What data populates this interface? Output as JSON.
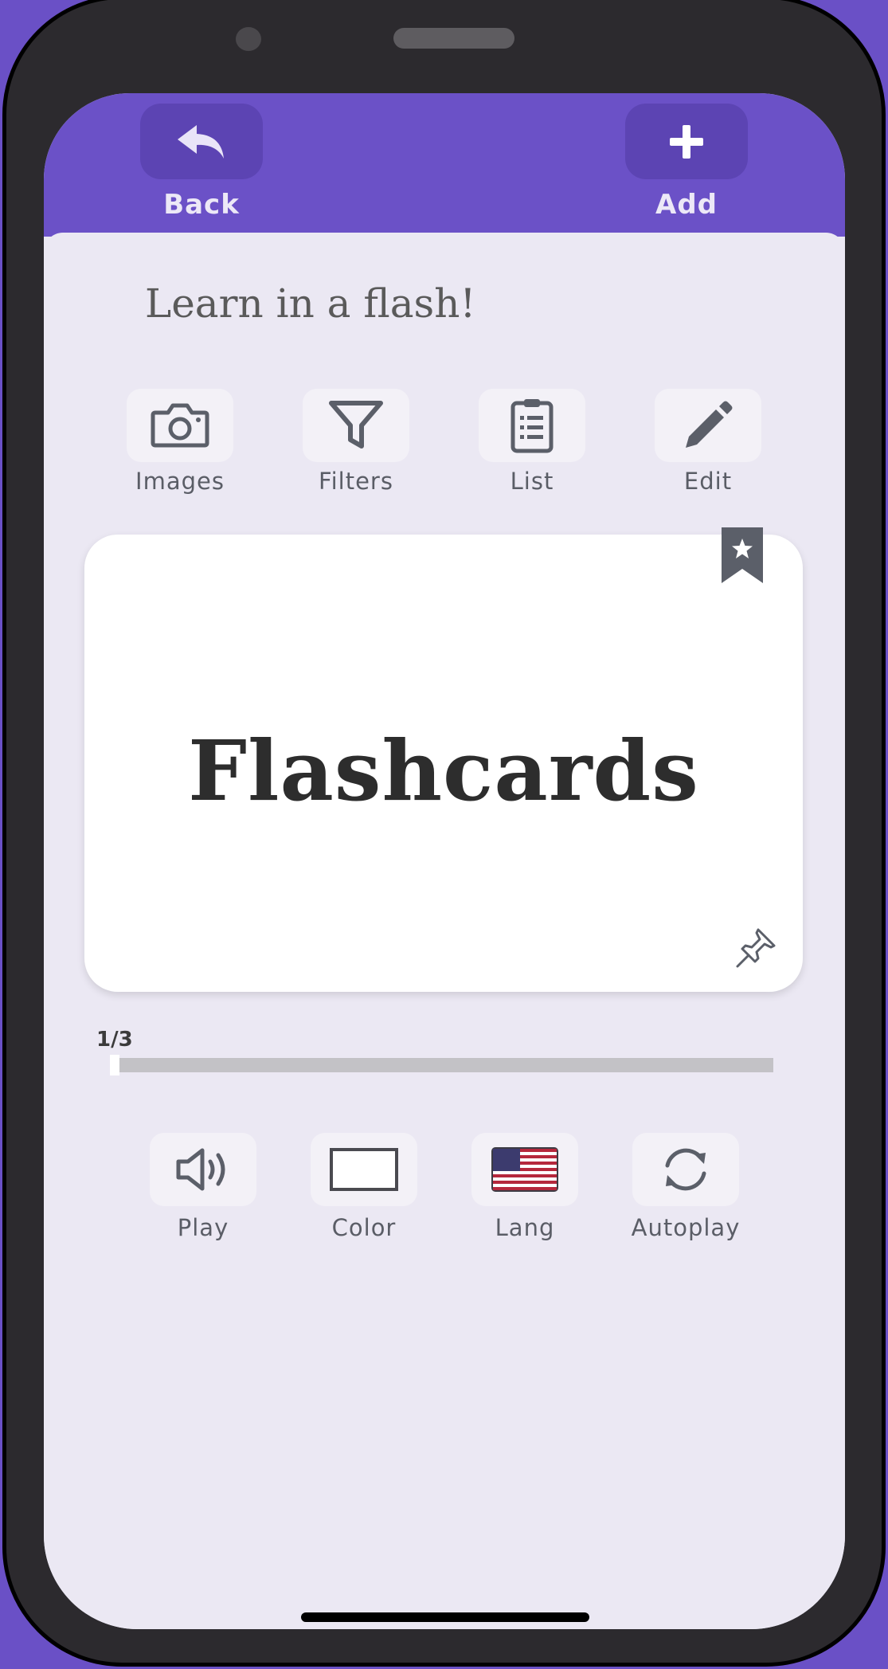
{
  "header": {
    "back_label": "Back",
    "add_label": "Add"
  },
  "title": "Learn in a flash!",
  "toolbar": [
    {
      "label": "Images",
      "icon": "camera-icon"
    },
    {
      "label": "Filters",
      "icon": "filter-icon"
    },
    {
      "label": "List",
      "icon": "clipboard-list-icon"
    },
    {
      "label": "Edit",
      "icon": "pencil-icon"
    }
  ],
  "card": {
    "word": "Flashcards",
    "bookmark_icon": "bookmark-star-icon",
    "pin_icon": "pin-icon"
  },
  "progress": {
    "text": "1/3",
    "current": 1,
    "total": 3
  },
  "actions": [
    {
      "label": "Play",
      "icon": "speaker-icon"
    },
    {
      "label": "Color",
      "icon": "color-swatch-icon"
    },
    {
      "label": "Lang",
      "icon": "us-flag-icon"
    },
    {
      "label": "Autoplay",
      "icon": "refresh-icon"
    }
  ],
  "colors": {
    "accent": "#6b51c7",
    "background": "#ebe8f3",
    "card": "#ffffff"
  }
}
